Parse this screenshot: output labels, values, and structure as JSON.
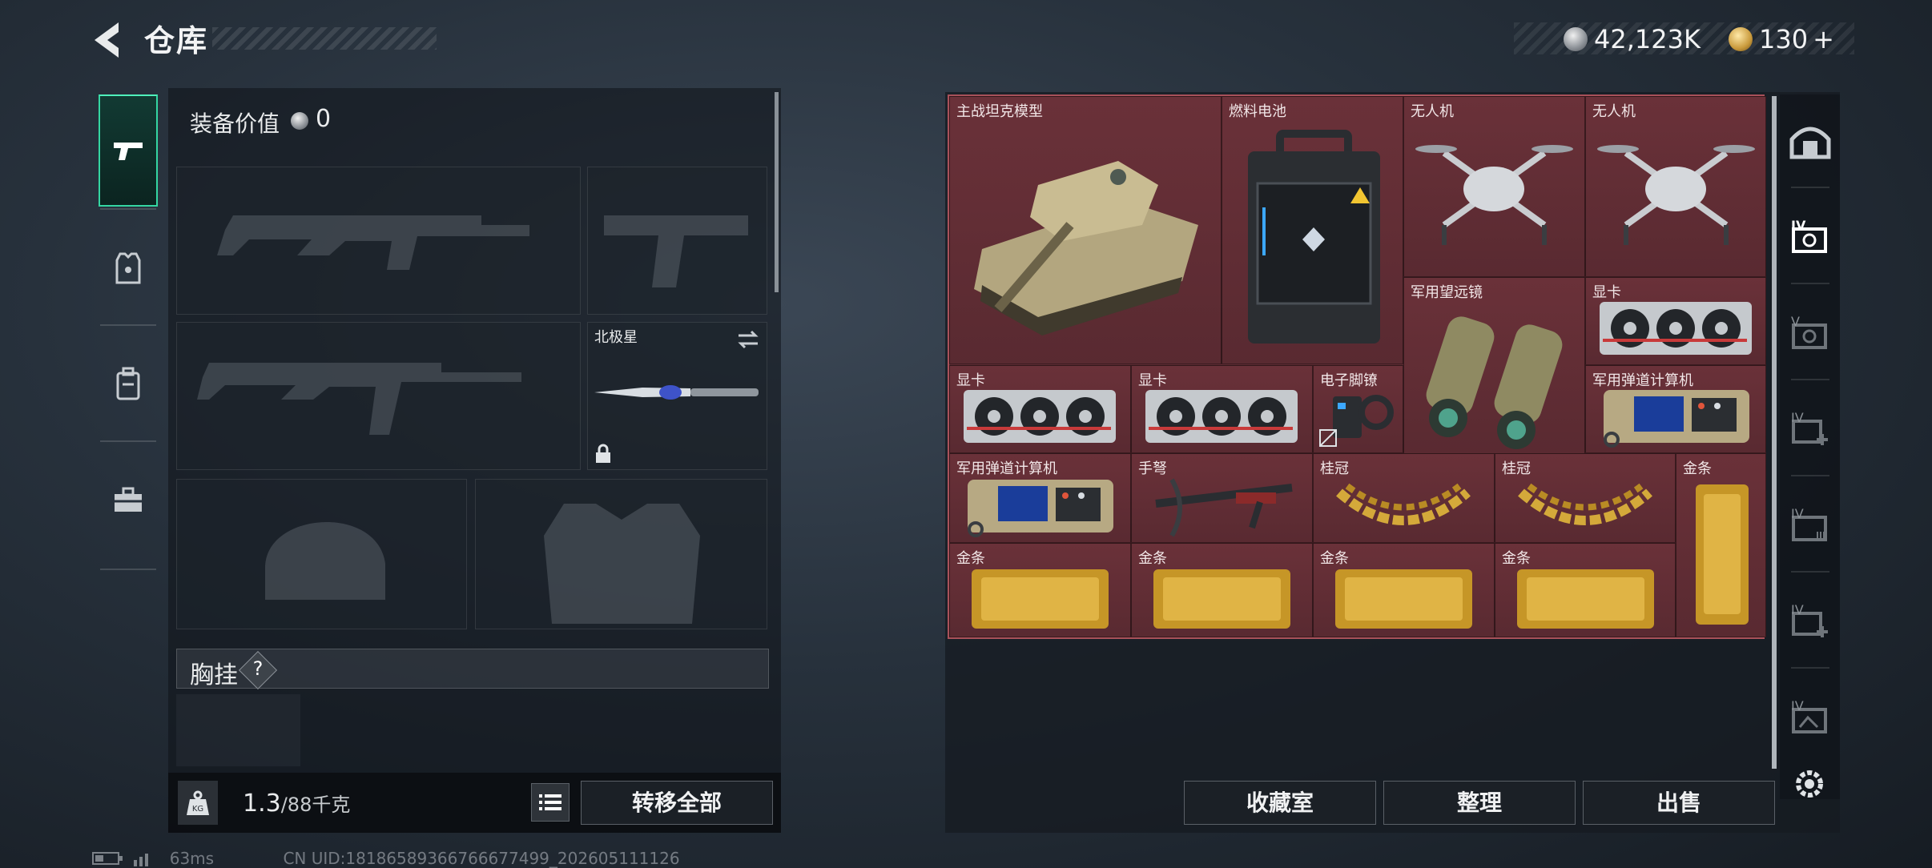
{
  "header": {
    "title": "仓库",
    "silver_amount": "42,123K",
    "gold_amount": "130",
    "gold_plus": "+"
  },
  "left_tabs": [
    "gun-icon",
    "armor-icon",
    "backpack-icon",
    "toolbox-icon"
  ],
  "equipment": {
    "value_label": "装备价值",
    "value": "0",
    "melee_slot_label": "北极星",
    "chest_rig_label": "胸挂",
    "chest_rig_help": "?"
  },
  "weight": {
    "current": "1.3",
    "max": "/88",
    "unit": "千克"
  },
  "buttons": {
    "transfer_all": "转移全部",
    "collection_room": "收藏室",
    "organize": "整理",
    "sell": "出售"
  },
  "stash_items": [
    {
      "label": "主战坦克模型",
      "icon": "tank-icon"
    },
    {
      "label": "燃料电池",
      "icon": "fuel-cell-icon"
    },
    {
      "label": "无人机",
      "icon": "drone-icon"
    },
    {
      "label": "无人机",
      "icon": "drone-icon"
    },
    {
      "label": "军用望远镜",
      "icon": "binoculars-icon"
    },
    {
      "label": "显卡",
      "icon": "gpu-icon"
    },
    {
      "label": "显卡",
      "icon": "gpu-icon"
    },
    {
      "label": "显卡",
      "icon": "gpu-icon"
    },
    {
      "label": "电子脚镣",
      "icon": "ankle-monitor-icon"
    },
    {
      "label": "军用弹道计算机",
      "icon": "ballistic-computer-icon"
    },
    {
      "label": "军用弹道计算机",
      "icon": "ballistic-computer-icon"
    },
    {
      "label": "手弩",
      "icon": "crossbow-icon"
    },
    {
      "label": "桂冠",
      "icon": "laurel-icon"
    },
    {
      "label": "桂冠",
      "icon": "laurel-icon"
    },
    {
      "label": "金条",
      "icon": "gold-bar-icon"
    },
    {
      "label": "金条",
      "icon": "gold-bar-icon"
    },
    {
      "label": "金条",
      "icon": "gold-bar-icon"
    },
    {
      "label": "金条",
      "icon": "gold-bar-icon"
    },
    {
      "label": "金条",
      "icon": "gold-bar-icon"
    }
  ],
  "right_rail": [
    {
      "icon": "vault-icon",
      "badge": ""
    },
    {
      "icon": "stash-tier-icon",
      "badge": "IV"
    },
    {
      "icon": "stash-tier-icon",
      "badge": "V"
    },
    {
      "icon": "stash-add-icon",
      "badge": "IV"
    },
    {
      "icon": "stash-tier-icon",
      "badge": "IV"
    },
    {
      "icon": "stash-add-icon",
      "badge": "IV"
    },
    {
      "icon": "stash-tier-icon",
      "badge": "IV"
    }
  ],
  "status": {
    "ping": "63ms",
    "uid": "CN UID:18186589366766677499_202605111126"
  }
}
